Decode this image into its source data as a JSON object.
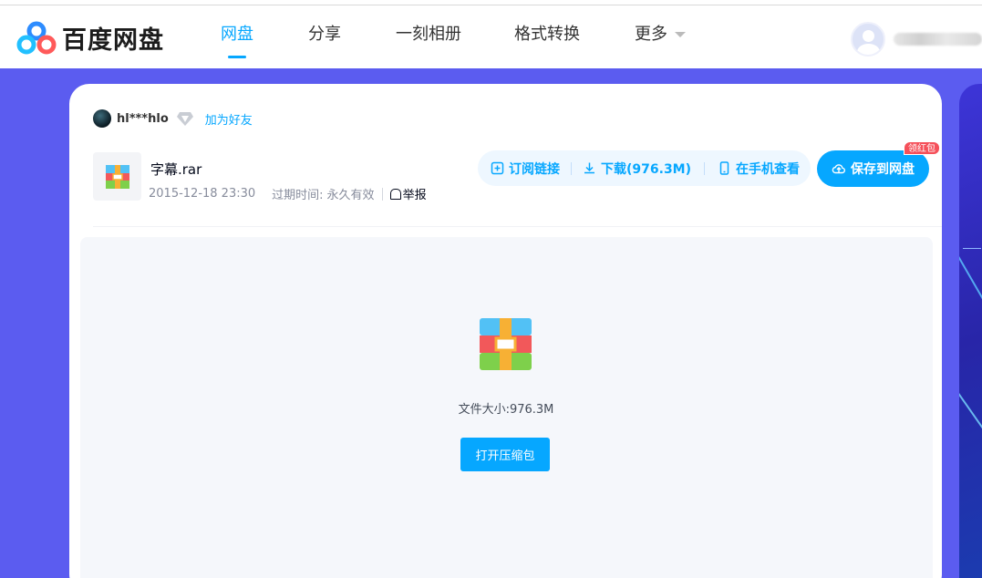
{
  "header": {
    "logo_text": "百度网盘",
    "nav": [
      {
        "label": "网盘",
        "active": true
      },
      {
        "label": "分享",
        "active": false
      },
      {
        "label": "一刻相册",
        "active": false
      },
      {
        "label": "格式转换",
        "active": false
      },
      {
        "label": "更多",
        "active": false
      }
    ]
  },
  "sharer": {
    "name": "hl***hlo",
    "add_friend": "加为好友"
  },
  "file": {
    "name": "字幕.rar",
    "date": "2015-12-18 23:30",
    "expire_label": "过期时间:",
    "expire_value": "永久有效",
    "report": "举报"
  },
  "actions": {
    "subscribe": "订阅链接",
    "download": "下载(976.3M)",
    "phone_view": "在手机查看",
    "save": "保存到网盘",
    "red_badge": "领红包"
  },
  "preview": {
    "size_text": "文件大小:976.3M",
    "open_button": "打开压缩包"
  },
  "colors": {
    "accent": "#06a7ff",
    "background": "#5b5cf0",
    "badge": "#f5505a"
  }
}
